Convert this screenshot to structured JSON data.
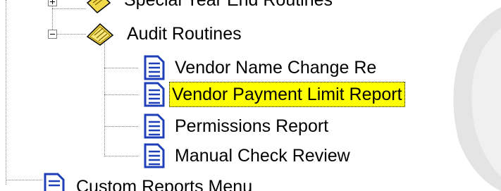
{
  "tree": {
    "items": [
      {
        "label": "Special Year End Routines",
        "icon": "folder-notepad-icon",
        "expander": "plus",
        "state": "partially-visible"
      },
      {
        "label": "Audit Routines",
        "icon": "folder-notepad-icon",
        "expander": "minus"
      },
      {
        "label": "Vendor Name Change Re",
        "icon": "report-document-icon"
      },
      {
        "label": "Vendor Payment Limit Report",
        "icon": "report-document-icon",
        "selected": true
      },
      {
        "label": "Permissions Report",
        "icon": "report-document-icon"
      },
      {
        "label": "Manual Check Review",
        "icon": "report-document-icon"
      },
      {
        "label": "Custom Reports Menu",
        "icon": "report-document-icon",
        "state": "partially-visible"
      }
    ]
  },
  "colors": {
    "selection": "#ffff00",
    "connector": "#808080",
    "folder": "#f0d848",
    "document": "#1f3fb8"
  }
}
